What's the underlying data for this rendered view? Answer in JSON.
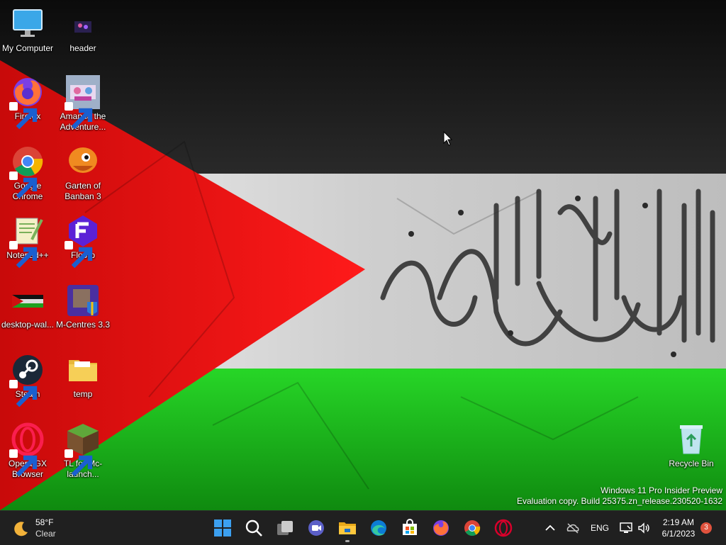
{
  "desktop": {
    "icons": [
      {
        "label": "My Computer",
        "icon": "monitor-icon"
      },
      {
        "label": "header",
        "icon": "image-icon"
      },
      {
        "label": "Firefox",
        "icon": "firefox-icon"
      },
      {
        "label": "Amanda the Adventure...",
        "icon": "game-thumbnail-icon"
      },
      {
        "label": "Google Chrome",
        "icon": "chrome-icon"
      },
      {
        "label": "Garten of Banban 3",
        "icon": "banban-icon"
      },
      {
        "label": "Notepad++",
        "icon": "notepadpp-icon"
      },
      {
        "label": "Floorp",
        "icon": "floorp-icon"
      },
      {
        "label": "desktop-wal...",
        "icon": "image-file-icon"
      },
      {
        "label": "M-Centres 3.3",
        "icon": "mcentres-icon"
      },
      {
        "label": "Steam",
        "icon": "steam-icon"
      },
      {
        "label": "temp",
        "icon": "folder-icon"
      },
      {
        "label": "Opera GX Browser",
        "icon": "opera-gx-icon"
      },
      {
        "label": "TL for Mc-launch...",
        "icon": "minecraft-icon"
      },
      {
        "label": "Recycle Bin",
        "icon": "recycle-bin-icon"
      }
    ]
  },
  "watermark": {
    "line1": "Windows 11 Pro Insider Preview",
    "line2": "Evaluation copy. Build 25375.zn_release.230520-1632"
  },
  "taskbar": {
    "weather": {
      "temp": "58°F",
      "condition": "Clear",
      "icon": "moon-icon"
    },
    "apps": [
      "start-icon",
      "search-icon",
      "task-view-icon",
      "chat-icon",
      "file-explorer-icon",
      "edge-icon",
      "store-icon",
      "firefox-icon",
      "chrome-icon",
      "opera-icon"
    ],
    "tray": {
      "language": "ENG",
      "time": "2:19 AM",
      "date": "6/1/2023",
      "notification_count": "3"
    }
  },
  "colors": {
    "flag_black": "#111111",
    "flag_white": "#dcdcdc",
    "flag_green": "#1fc61c",
    "flag_red": "#e01010",
    "taskbar_bg": "#202020"
  }
}
